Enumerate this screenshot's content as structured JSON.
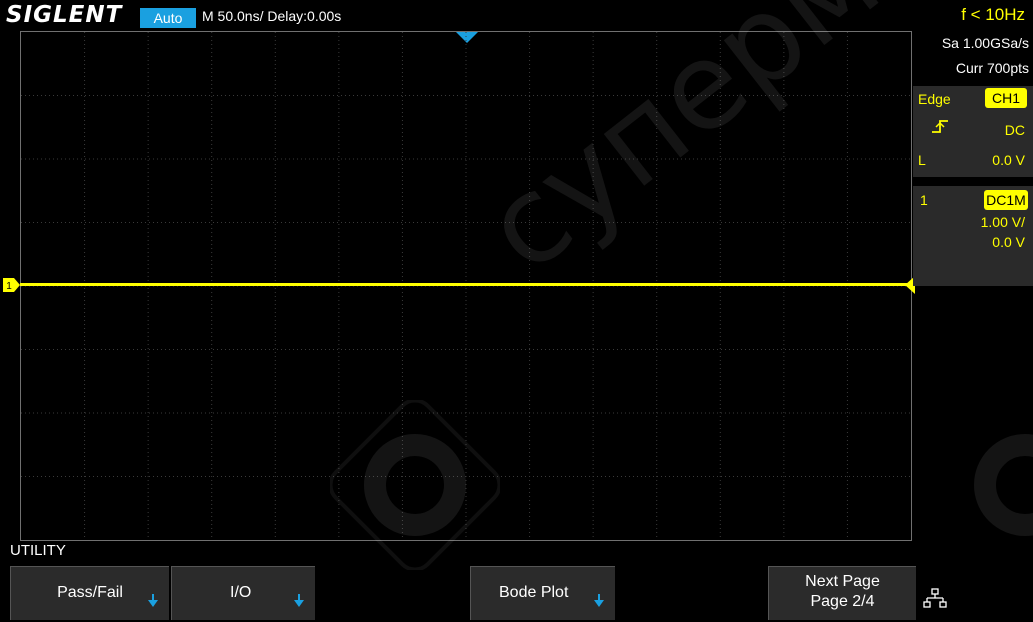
{
  "header": {
    "brand": "SIGLENT",
    "trigger_mode": "Auto",
    "timebase": "M 50.0ns/  Delay:0.00s",
    "frequency": "f < 10Hz"
  },
  "acquisition": {
    "sample_rate": "Sa 1.00GSa/s",
    "memory": "Curr 700pts"
  },
  "trigger": {
    "type": "Edge",
    "source": "CH1",
    "slope_icon": "rising-edge-icon",
    "coupling": "DC",
    "level_label": "L",
    "level": "0.0 V"
  },
  "channel1": {
    "number": "1",
    "coupling": "DC1M",
    "scale": "1.00 V/",
    "offset": "0.0 V",
    "marker": "1"
  },
  "menu": {
    "title": "UTILITY",
    "softkeys": [
      {
        "label": "Pass/Fail"
      },
      {
        "label": "I/O"
      },
      {
        "label": "Bode Plot"
      },
      {
        "label": "Next Page",
        "sublabel": "Page 2/4"
      }
    ],
    "network_icon": "network-icon"
  },
  "watermark": "супермаркет",
  "colors": {
    "channel1": "#ffff00",
    "accent": "#1aa0e0",
    "background": "#000000"
  }
}
